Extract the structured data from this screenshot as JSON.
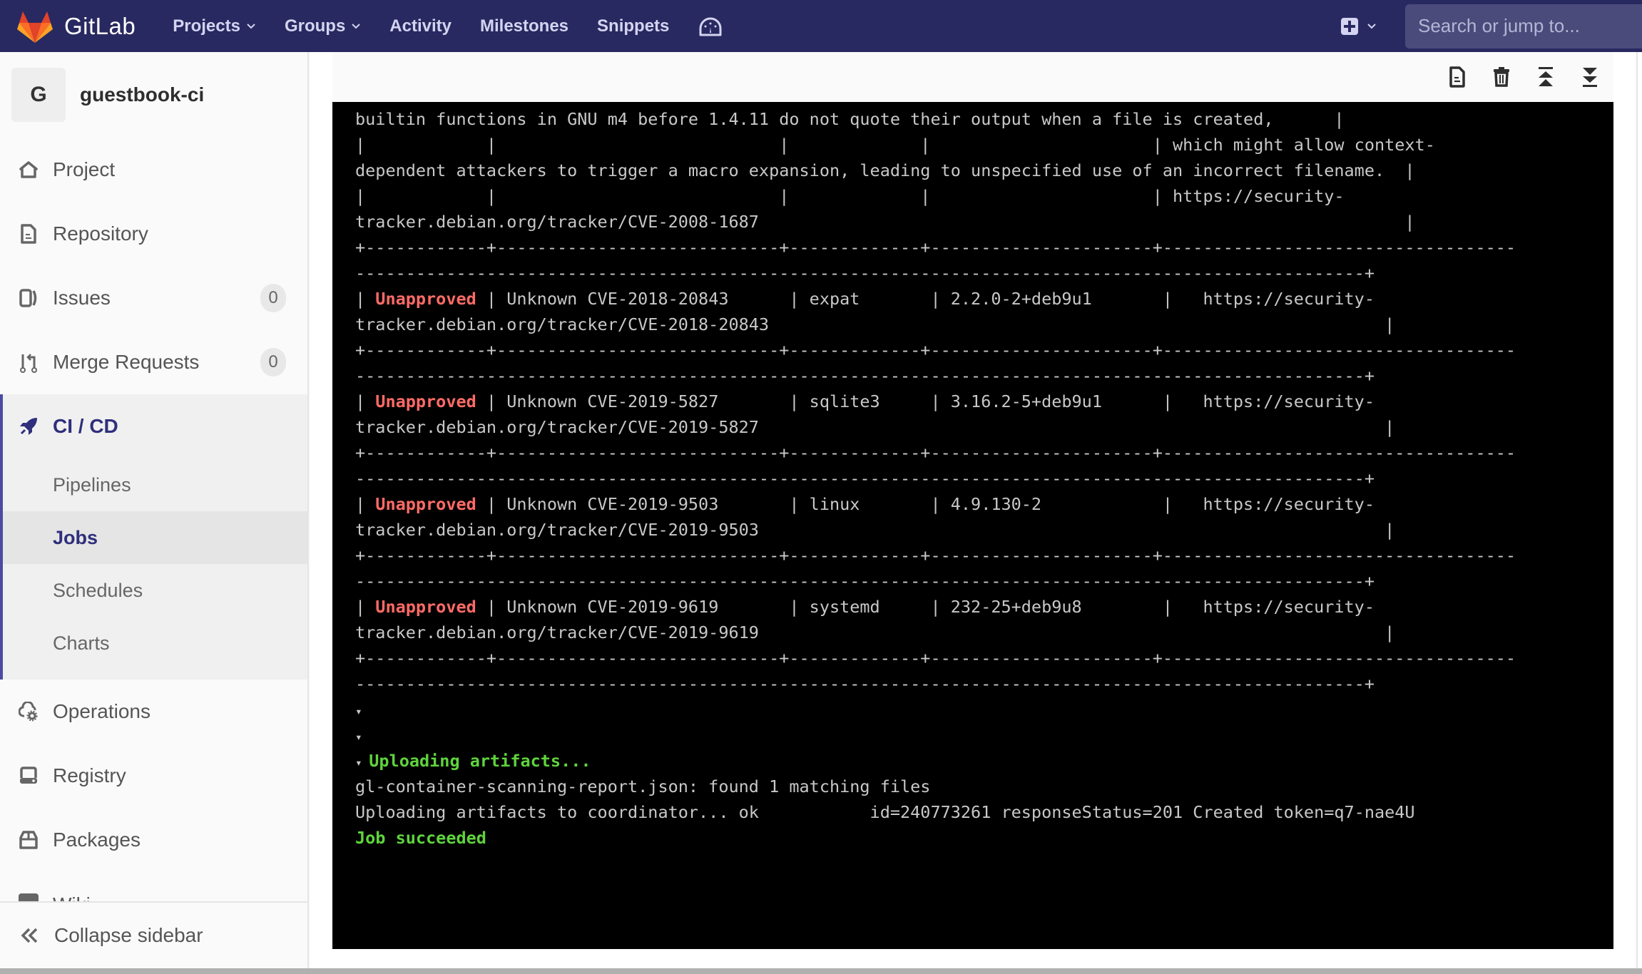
{
  "app": {
    "name": "GitLab",
    "nav": [
      {
        "label": "Projects",
        "has_dropdown": true
      },
      {
        "label": "Groups",
        "has_dropdown": true
      },
      {
        "label": "Activity",
        "has_dropdown": false
      },
      {
        "label": "Milestones",
        "has_dropdown": false
      },
      {
        "label": "Snippets",
        "has_dropdown": false
      }
    ],
    "dashboard_icon": "dashboard-gauge-icon",
    "new_icon": "plus-square-icon",
    "search_placeholder": "Search or jump to...",
    "colors": {
      "header_bg": "#292961",
      "accent": "#2f2f7c",
      "unapproved": "#ff6b66",
      "success": "#5fd33d"
    }
  },
  "sidebar": {
    "project_avatar_letter": "G",
    "project_name": "guestbook-ci",
    "items": [
      {
        "label": "Project",
        "icon": "home-icon"
      },
      {
        "label": "Repository",
        "icon": "doc-icon"
      },
      {
        "label": "Issues",
        "icon": "issues-icon",
        "badge": "0"
      },
      {
        "label": "Merge Requests",
        "icon": "merge-request-icon",
        "badge": "0"
      },
      {
        "label": "CI / CD",
        "icon": "rocket-icon",
        "active": true,
        "children": [
          {
            "label": "Pipelines"
          },
          {
            "label": "Jobs",
            "active": true
          },
          {
            "label": "Schedules"
          },
          {
            "label": "Charts"
          }
        ]
      },
      {
        "label": "Operations",
        "icon": "cloud-gear-icon"
      },
      {
        "label": "Registry",
        "icon": "registry-icon"
      },
      {
        "label": "Packages",
        "icon": "package-icon"
      },
      {
        "label": "Wiki",
        "icon": "book-icon"
      }
    ],
    "collapse_label": "Collapse sidebar"
  },
  "job_toolbar": {
    "buttons": [
      "raw-log-icon",
      "erase-log-icon",
      "scroll-top-icon",
      "scroll-bottom-icon"
    ]
  },
  "log": {
    "lines": [
      [
        {
          "t": "builtin functions in GNU m4 before 1.4.11 do not quote their output when a file is created,      |"
        }
      ],
      [
        {
          "t": "|            |                            |             |                      | which might allow context-"
        }
      ],
      [
        {
          "t": "dependent attackers to trigger a macro expansion, leading to unspecified use of an incorrect filename.  |"
        }
      ],
      [
        {
          "t": "|            |                            |             |                      | https://security-"
        }
      ],
      [
        {
          "t": "tracker.debian.org/tracker/CVE-2008-1687                                                                |"
        }
      ],
      [
        {
          "t": "+------------+----------------------------+-------------+----------------------+-----------------------------------"
        }
      ],
      [
        {
          "t": "----------------------------------------------------------------------------------------------------+"
        }
      ],
      [
        {
          "t": "| "
        },
        {
          "t": "Unapproved",
          "c": "red"
        },
        {
          "t": " | Unknown CVE-2018-20843      | expat       | 2.2.0-2+deb9u1       |   https://security-"
        }
      ],
      [
        {
          "t": "tracker.debian.org/tracker/CVE-2018-20843                                                             |"
        }
      ],
      [
        {
          "t": "+------------+----------------------------+-------------+----------------------+-----------------------------------"
        }
      ],
      [
        {
          "t": "----------------------------------------------------------------------------------------------------+"
        }
      ],
      [
        {
          "t": "| "
        },
        {
          "t": "Unapproved",
          "c": "red"
        },
        {
          "t": " | Unknown CVE-2019-5827       | sqlite3     | 3.16.2-5+deb9u1      |   https://security-"
        }
      ],
      [
        {
          "t": "tracker.debian.org/tracker/CVE-2019-5827                                                              |"
        }
      ],
      [
        {
          "t": "+------------+----------------------------+-------------+----------------------+-----------------------------------"
        }
      ],
      [
        {
          "t": "----------------------------------------------------------------------------------------------------+"
        }
      ],
      [
        {
          "t": "| "
        },
        {
          "t": "Unapproved",
          "c": "red"
        },
        {
          "t": " | Unknown CVE-2019-9503       | linux       | 4.9.130-2            |   https://security-"
        }
      ],
      [
        {
          "t": "tracker.debian.org/tracker/CVE-2019-9503                                                              |"
        }
      ],
      [
        {
          "t": "+------------+----------------------------+-------------+----------------------+-----------------------------------"
        }
      ],
      [
        {
          "t": "----------------------------------------------------------------------------------------------------+"
        }
      ],
      [
        {
          "t": "| "
        },
        {
          "t": "Unapproved",
          "c": "red"
        },
        {
          "t": " | Unknown CVE-2019-9619       | systemd     | 232-25+deb9u8        |   https://security-"
        }
      ],
      [
        {
          "t": "tracker.debian.org/tracker/CVE-2019-9619                                                              |"
        }
      ],
      [
        {
          "t": "+------------+----------------------------+-------------+----------------------+-----------------------------------"
        }
      ],
      [
        {
          "t": "----------------------------------------------------------------------------------------------------+"
        }
      ],
      [
        {
          "t": "▾",
          "c": "tri"
        }
      ],
      [
        {
          "t": "▾",
          "c": "tri"
        }
      ],
      [
        {
          "t": "▾ ",
          "c": "tri"
        },
        {
          "t": "Uploading artifacts...",
          "c": "green"
        }
      ],
      [
        {
          "t": "gl-container-scanning-report.json: found 1 matching files"
        }
      ],
      [
        {
          "t": "Uploading artifacts to coordinator... ok           id=240773261 responseStatus=201 Created token=q7-nae4U"
        }
      ],
      [
        {
          "t": "Job succeeded",
          "c": "green"
        }
      ]
    ]
  }
}
